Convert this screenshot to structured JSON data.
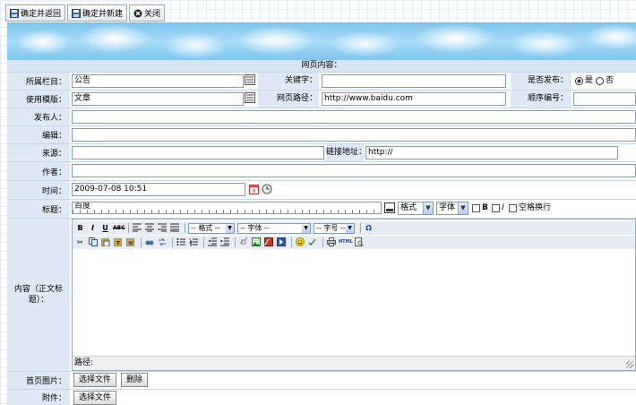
{
  "toolbar": {
    "save_return": "确定并返回",
    "save_new": "确定并新建",
    "close": "关闭"
  },
  "section_title": "网页内容：",
  "fields": {
    "column": {
      "label": "所属栏目：",
      "value": "公告"
    },
    "keywords": {
      "label": "关键字：",
      "value": ""
    },
    "publish": {
      "label": "是否发布：",
      "yes": "是",
      "no": "否",
      "selected": "yes"
    },
    "template": {
      "label": "使用模版：",
      "value": "文章"
    },
    "page_path": {
      "label": "网页路径：",
      "value": "http://www.baidu.com"
    },
    "order": {
      "label": "顺序编号：",
      "value": ""
    },
    "publisher": {
      "label": "发布人：",
      "value": ""
    },
    "editor": {
      "label": "编辑：",
      "value": ""
    },
    "source": {
      "label": "来源：",
      "value": "",
      "link_label": "链接地址：",
      "link_value": "http://"
    },
    "author": {
      "label": "作者：",
      "value": ""
    },
    "time": {
      "label": "时间：",
      "value": "2009-07-08 10:51"
    },
    "title": {
      "label": "标题：",
      "value": "百度",
      "format_value": "格式",
      "font_value": "字体",
      "bold": "B",
      "italic": "I",
      "space_wrap": "空格换行"
    },
    "content": {
      "label": "内容（正文标题）：",
      "format_select": "-- 格式 --",
      "font_select": "-- 字体 --",
      "size_select": "-- 字号 --",
      "path_label": "路径:"
    },
    "home_image": {
      "label": "首页图片：",
      "choose": "选择文件",
      "delete": "删除"
    },
    "attachment": {
      "label": "附件：",
      "choose": "选择文件"
    }
  },
  "colors": {
    "label_bg": "#dfe9f5",
    "section_bg": "#d6e3f2",
    "border": "#c5d6ea"
  }
}
